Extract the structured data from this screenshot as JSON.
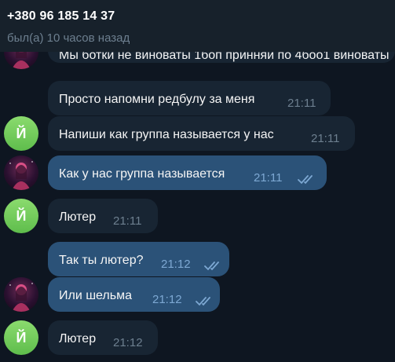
{
  "header": {
    "title": "+380 96 185 14 37",
    "status": "был(а) 10 часов назад"
  },
  "partial_message": {
    "text": "Мы ботки не виноваты 1боп принняи по 4боо1 виноваты"
  },
  "messages": [
    {
      "text": "Просто напомни редбулу за меня",
      "time": "21:11",
      "read": false
    },
    {
      "text": "Напиши как группа называется у нас",
      "time": "21:11",
      "read": false
    },
    {
      "text": "Как у нас группа называется",
      "time": "21:11",
      "read": true
    },
    {
      "text": "Лютер",
      "time": "21:11",
      "read": false
    },
    {
      "text": "Так ты лютер?",
      "time": "21:12",
      "read": true
    },
    {
      "text": "Или шельма",
      "time": "21:12",
      "read": true
    },
    {
      "text": "Лютер",
      "time": "21:12",
      "read": false
    }
  ],
  "avatars": {
    "initial": "Й",
    "initial_color": "#6fcf55",
    "photo_icon": "user-photo-icon"
  },
  "colors": {
    "background": "#0e1621",
    "header": "#17212b",
    "incoming_bubble": "#182533",
    "outgoing_bubble": "#2b5278",
    "read_check": "#7da8d3"
  }
}
